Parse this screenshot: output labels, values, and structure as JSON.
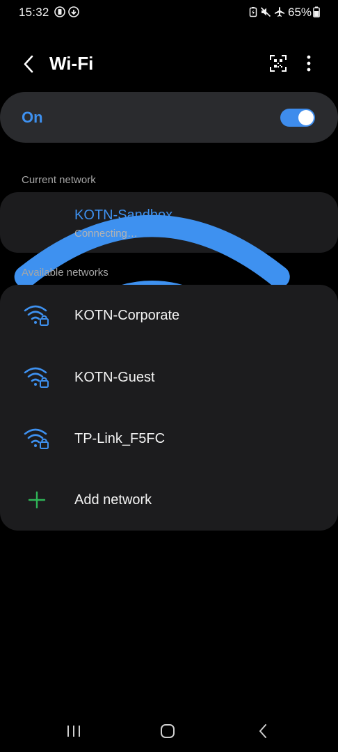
{
  "status_bar": {
    "time": "15:32",
    "battery_percent": "65%",
    "left_icons": [
      "battery-saver-icon",
      "sync-icon"
    ],
    "right_icons": [
      "battery-charge-icon",
      "mute-icon",
      "airplane-mode-icon",
      "battery-icon"
    ]
  },
  "header": {
    "title": "Wi-Fi",
    "back_icon": "back-arrow-icon",
    "qr_icon": "qr-scan-icon",
    "more_icon": "more-vertical-icon"
  },
  "toggle": {
    "label": "On",
    "state": true,
    "accent_color": "#3e91f0"
  },
  "current_network": {
    "section_label": "Current network",
    "name": "KOTN-Sandbox",
    "status": "Connecting…",
    "icon": "wifi-lock-icon"
  },
  "available_networks": {
    "section_label": "Available networks",
    "items": [
      {
        "name": "KOTN-Corporate",
        "icon": "wifi-lock-icon"
      },
      {
        "name": "KOTN-Guest",
        "icon": "wifi-lock-icon"
      },
      {
        "name": "TP-Link_F5FC",
        "icon": "wifi-lock-icon"
      }
    ],
    "add_label": "Add network",
    "add_icon": "plus-icon",
    "add_icon_color": "#2fb457"
  },
  "nav_bar": {
    "recents_icon": "recents-icon",
    "home_icon": "home-icon",
    "back_icon": "nav-back-icon"
  }
}
